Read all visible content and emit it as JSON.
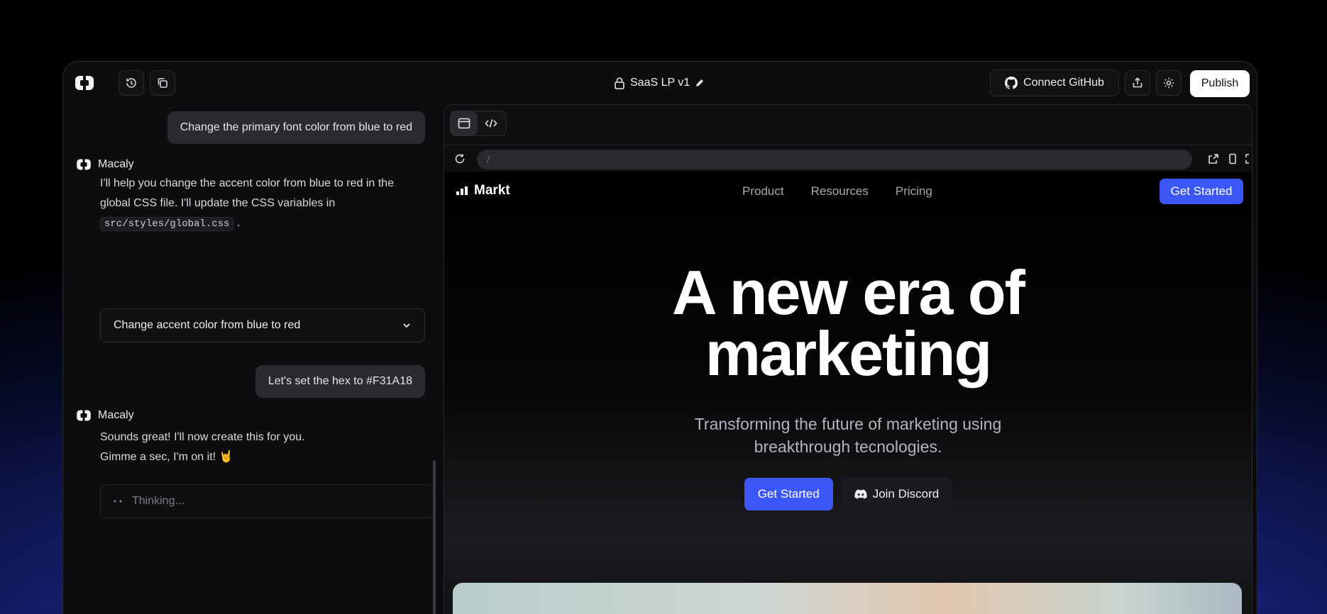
{
  "header": {
    "project_title": "SaaS LP v1",
    "connect_github_label": "Connect GitHub",
    "publish_label": "Publish"
  },
  "chat": {
    "messages": [
      {
        "role": "user",
        "text": "Change the primary font color from blue to red"
      },
      {
        "role": "assistant",
        "name": "Macaly",
        "text_before": "I'll help you change the accent color from blue to red in the global CSS file. I'll update the CSS variables in",
        "code": "src/styles/global.css",
        "text_after": "."
      },
      {
        "role": "card",
        "text": "Change accent color from blue to red"
      },
      {
        "role": "user",
        "text": "Let's set the hex to #F31A18"
      },
      {
        "role": "assistant",
        "name": "Macaly",
        "line1": "Sounds great! I'll now create this for you.",
        "line2": "Gimme a sec, I'm on it! 🤘"
      }
    ],
    "thinking_label": "Thinking..."
  },
  "preview": {
    "url": "/",
    "site": {
      "brand": "Markt",
      "nav_links": [
        "Product",
        "Resources",
        "Pricing"
      ],
      "nav_cta": "Get Started",
      "hero_title_line1": "A new era of",
      "hero_title_line2": "marketing",
      "hero_sub_line1": "Transforming the future of marketing using",
      "hero_sub_line2": "breakthrough tecnologies.",
      "primary_cta": "Get Started",
      "secondary_cta": "Join Discord"
    }
  },
  "colors": {
    "accent": "#3b57f5",
    "publish_bg": "#ffffff",
    "window_bg": "#0d0d0f"
  },
  "icons": {
    "logo": "macaly-logo-icon",
    "history": "history-icon",
    "copy": "copy-icon",
    "lock": "lock-icon",
    "edit": "pencil-icon",
    "github": "github-icon",
    "share": "share-icon",
    "settings": "gear-icon",
    "preview_mode": "window-icon",
    "code_mode": "code-icon",
    "refresh": "refresh-icon",
    "open_external": "open-external-icon",
    "device": "mobile-device-icon",
    "fullscreen": "fullscreen-icon",
    "discord": "discord-icon"
  }
}
